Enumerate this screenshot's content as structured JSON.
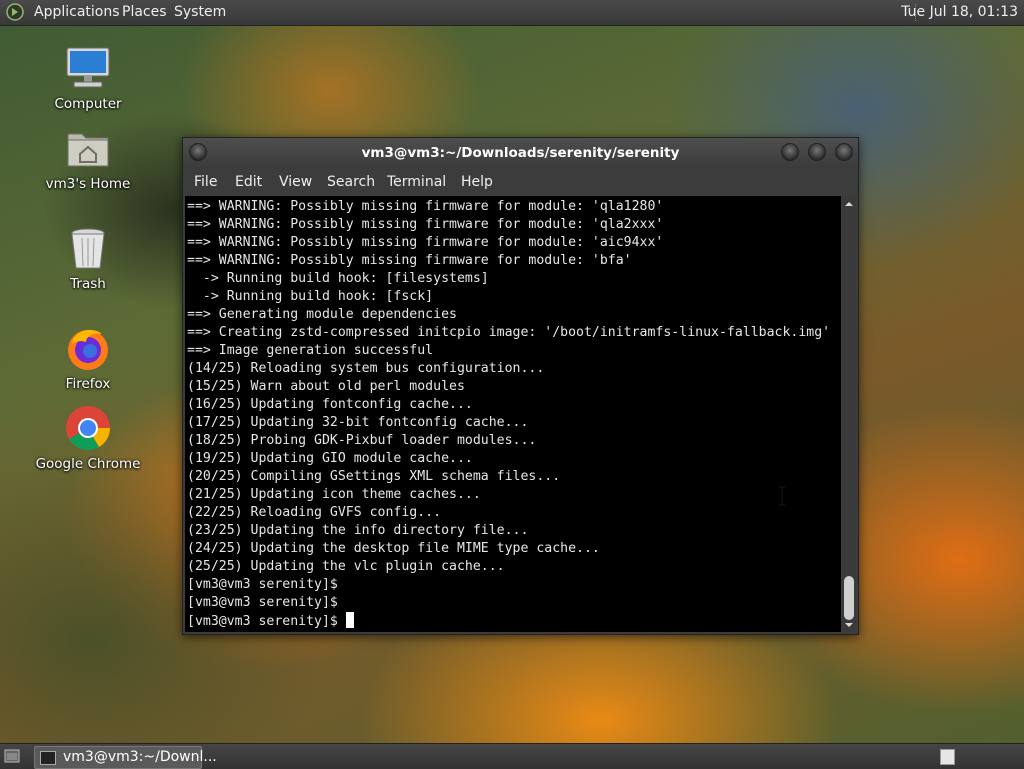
{
  "top_panel": {
    "menus": [
      "Applications",
      "Places",
      "System"
    ],
    "clock": "Tue Jul 18, 01:13"
  },
  "desktop": {
    "icons": [
      {
        "label": "Computer",
        "icon": "computer-icon"
      },
      {
        "label": "vm3's Home",
        "icon": "home-folder-icon"
      },
      {
        "label": "Trash",
        "icon": "trash-icon"
      },
      {
        "label": "Firefox",
        "icon": "firefox-icon"
      },
      {
        "label": "Google Chrome",
        "icon": "chrome-icon"
      }
    ]
  },
  "window": {
    "title": "vm3@vm3:~/Downloads/serenity/serenity",
    "menu": [
      "File",
      "Edit",
      "View",
      "Search",
      "Terminal",
      "Help"
    ],
    "terminal_lines": [
      "==> WARNING: Possibly missing firmware for module: 'qla1280'",
      "==> WARNING: Possibly missing firmware for module: 'qla2xxx'",
      "==> WARNING: Possibly missing firmware for module: 'aic94xx'",
      "==> WARNING: Possibly missing firmware for module: 'bfa'",
      "  -> Running build hook: [filesystems]",
      "  -> Running build hook: [fsck]",
      "==> Generating module dependencies",
      "==> Creating zstd-compressed initcpio image: '/boot/initramfs-linux-fallback.img'",
      "==> Image generation successful",
      "(14/25) Reloading system bus configuration...",
      "(15/25) Warn about old perl modules",
      "(16/25) Updating fontconfig cache...",
      "(17/25) Updating 32-bit fontconfig cache...",
      "(18/25) Probing GDK-Pixbuf loader modules...",
      "(19/25) Updating GIO module cache...",
      "(20/25) Compiling GSettings XML schema files...",
      "(21/25) Updating icon theme caches...",
      "(22/25) Reloading GVFS config...",
      "(23/25) Updating the info directory file...",
      "(24/25) Updating the desktop file MIME type cache...",
      "(25/25) Updating the vlc plugin cache...",
      "[vm3@vm3 serenity]$",
      "[vm3@vm3 serenity]$"
    ],
    "prompt": "[vm3@vm3 serenity]$ "
  },
  "taskbar": {
    "task_label": "vm3@vm3:~/Downl..."
  },
  "colors": {
    "panel": "#3c3c3c",
    "terminal_bg": "#000000",
    "terminal_fg": "#e6e6e6"
  }
}
